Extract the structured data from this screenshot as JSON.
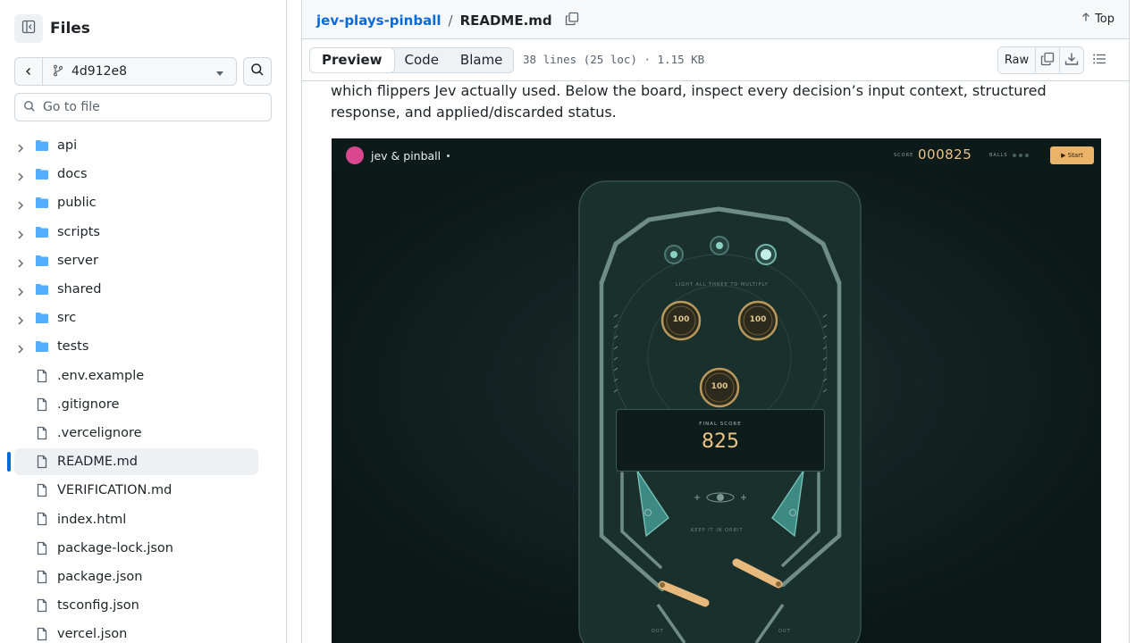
{
  "sidebar": {
    "title": "Files",
    "branch": "4d912e8",
    "goto_placeholder": "Go to file",
    "items": [
      {
        "name": "api",
        "type": "folder"
      },
      {
        "name": "docs",
        "type": "folder"
      },
      {
        "name": "public",
        "type": "folder"
      },
      {
        "name": "scripts",
        "type": "folder"
      },
      {
        "name": "server",
        "type": "folder"
      },
      {
        "name": "shared",
        "type": "folder"
      },
      {
        "name": "src",
        "type": "folder"
      },
      {
        "name": "tests",
        "type": "folder"
      },
      {
        "name": ".env.example",
        "type": "file"
      },
      {
        "name": ".gitignore",
        "type": "file"
      },
      {
        "name": ".vercelignore",
        "type": "file"
      },
      {
        "name": "README.md",
        "type": "file",
        "selected": true
      },
      {
        "name": "VERIFICATION.md",
        "type": "file"
      },
      {
        "name": "index.html",
        "type": "file"
      },
      {
        "name": "package-lock.json",
        "type": "file"
      },
      {
        "name": "package.json",
        "type": "file"
      },
      {
        "name": "tsconfig.json",
        "type": "file"
      },
      {
        "name": "vercel.json",
        "type": "file"
      }
    ]
  },
  "header": {
    "repo": "jev-plays-pinball",
    "separator": "/",
    "file": "README.md",
    "top_label": "Top"
  },
  "toolbar": {
    "tabs": [
      "Preview",
      "Code",
      "Blame"
    ],
    "active_tab": "Preview",
    "meta": "38 lines (25 loc) · 1.15 KB",
    "raw_label": "Raw"
  },
  "content": {
    "paragraph": "which flippers Jev actually used. Below the board, inspect every decision’s input context, structured response, and applied/discarded status."
  },
  "screenshot": {
    "brand": "jev & pinball",
    "score_label": "SCORE",
    "score": "000825",
    "balls_label": "BALLS",
    "start_label": "▶ Start",
    "multiplier_text": "LIGHT ALL THREE TO MULTIPLY",
    "bumpers": [
      "100",
      "100",
      "100"
    ],
    "final_label": "FINAL SCORE",
    "final_score": "825",
    "keep_text": "KEEP IT IN ORBIT",
    "out_left": "OUT",
    "out_right": "OUT"
  },
  "colors": {
    "link": "#0969da",
    "selected_bar": "#0969da",
    "folder": "#54aeff",
    "board_bg": "#0d1a1a",
    "score": "#e8c48a",
    "start_button": "#e9b46a",
    "logo": "#d9478e"
  },
  "icons": {
    "sidebar_toggle": "sidebar-collapse-icon",
    "back": "chevron-left-icon",
    "branch": "git-branch-icon",
    "caret": "triangle-down-icon",
    "search": "search-icon",
    "folder": "folder-icon",
    "file": "file-icon",
    "copy": "copy-icon",
    "top": "arrow-up-icon",
    "download": "download-icon",
    "outline": "list-unordered-icon"
  }
}
